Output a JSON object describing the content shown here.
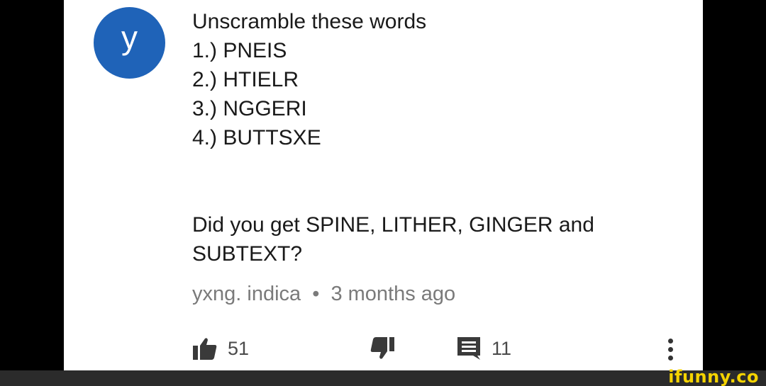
{
  "avatar": {
    "letter": "y",
    "color": "#1f63b8"
  },
  "comment": {
    "lines": [
      "Unscramble these words",
      "1.) PNEIS",
      "2.) HTIELR",
      "3.) NGGERI",
      "4.) BUTTSXE"
    ],
    "followup_lines": [
      "Did you get SPINE, LITHER, GINGER and",
      "SUBTEXT?"
    ]
  },
  "meta": {
    "author": "yxng. indica",
    "separator": "•",
    "time": "3 months ago"
  },
  "actions": {
    "like_count": "51",
    "dislike_count": "",
    "reply_count": "11",
    "like_icon": "thumbs-up-icon",
    "dislike_icon": "thumbs-down-icon",
    "reply_icon": "comment-icon",
    "more_icon": "more-vertical-icon"
  },
  "watermark": {
    "text": "ifunny.co",
    "color": "#f5d300"
  }
}
